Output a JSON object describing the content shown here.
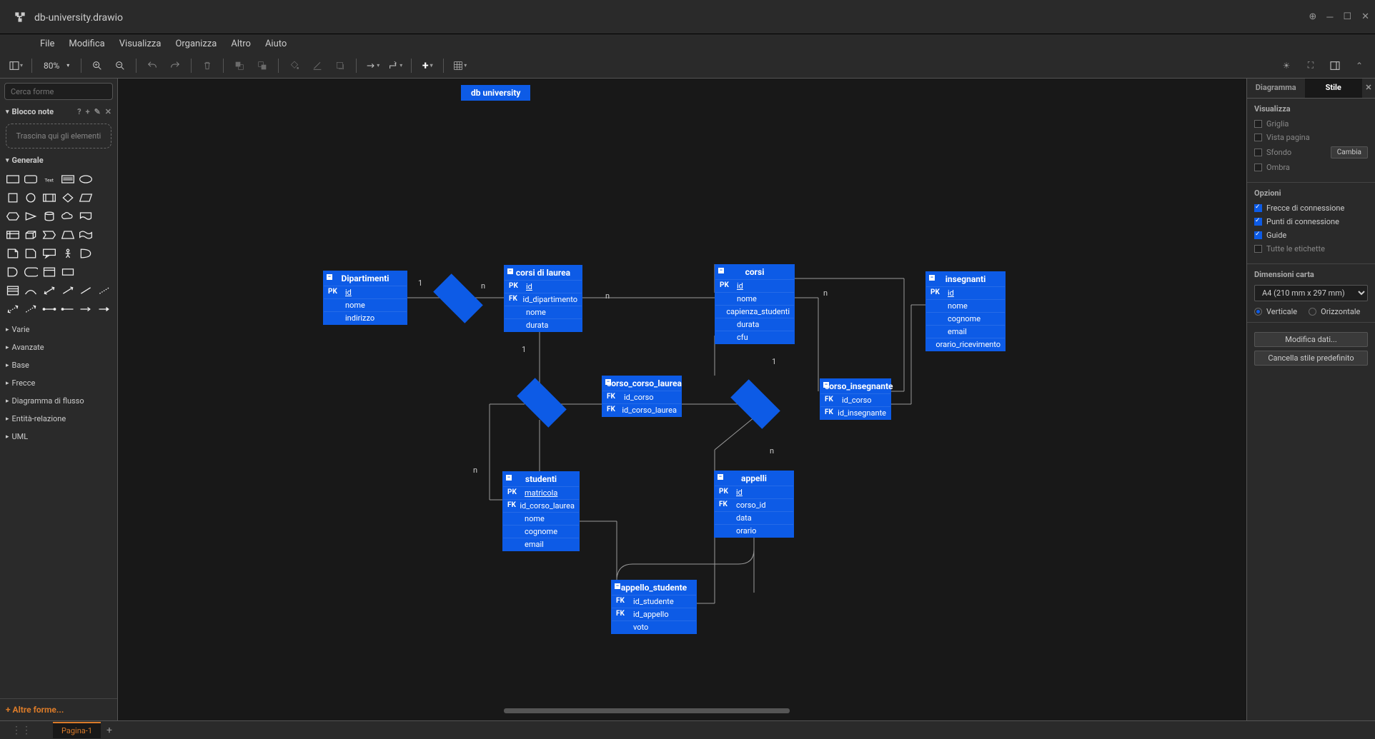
{
  "title": "db-university.drawio",
  "menubar": [
    "File",
    "Modifica",
    "Visualizza",
    "Organizza",
    "Altro",
    "Aiuto"
  ],
  "zoom": "80%",
  "search_placeholder": "Cerca forme",
  "left": {
    "scratchpad": "Blocco note",
    "dropzone": "Trascina qui gli elementi",
    "general": "Generale",
    "categories": [
      "Varie",
      "Avanzate",
      "Base",
      "Frecce",
      "Diagramma di flusso",
      "Entità-relazione",
      "UML"
    ],
    "more": "+  Altre forme..."
  },
  "canvas": {
    "title_chip": "db university",
    "tables": {
      "dipartimenti": {
        "title": "Dipartimenti",
        "rows": [
          {
            "k": "PK",
            "f": "id",
            "u": true
          },
          {
            "k": "",
            "f": "nome"
          },
          {
            "k": "",
            "f": "indirizzo"
          }
        ]
      },
      "corsi_laurea": {
        "title": "corsi di laurea",
        "rows": [
          {
            "k": "PK",
            "f": "id",
            "u": true
          },
          {
            "k": "FK",
            "f": "id_dipartimento"
          },
          {
            "k": "",
            "f": "nome"
          },
          {
            "k": "",
            "f": "durata"
          }
        ]
      },
      "corsi": {
        "title": "corsi",
        "rows": [
          {
            "k": "PK",
            "f": "id",
            "u": true
          },
          {
            "k": "",
            "f": "nome"
          },
          {
            "k": "",
            "f": "capienza_studenti"
          },
          {
            "k": "",
            "f": "durata"
          },
          {
            "k": "",
            "f": "cfu"
          }
        ]
      },
      "insegnanti": {
        "title": "insegnanti",
        "rows": [
          {
            "k": "PK",
            "f": "id",
            "u": true
          },
          {
            "k": "",
            "f": "nome"
          },
          {
            "k": "",
            "f": "cognome"
          },
          {
            "k": "",
            "f": "email"
          },
          {
            "k": "",
            "f": "orario_ricevimento"
          }
        ]
      },
      "corso_corso_laurea": {
        "title": "corso_corso_laurea",
        "rows": [
          {
            "k": "FK",
            "f": "id_corso"
          },
          {
            "k": "FK",
            "f": "id_corso_laurea"
          }
        ]
      },
      "corso_insegnante": {
        "title": "corso_insegnante",
        "rows": [
          {
            "k": "FK",
            "f": "id_corso"
          },
          {
            "k": "FK",
            "f": "id_insegnante"
          }
        ]
      },
      "studenti": {
        "title": "studenti",
        "rows": [
          {
            "k": "PK",
            "f": "matricola",
            "u": true
          },
          {
            "k": "FK",
            "f": "id_corso_laurea"
          },
          {
            "k": "",
            "f": "nome"
          },
          {
            "k": "",
            "f": "cognome"
          },
          {
            "k": "",
            "f": "email"
          }
        ]
      },
      "appelli": {
        "title": "appelli",
        "rows": [
          {
            "k": "PK",
            "f": "id",
            "u": true
          },
          {
            "k": "FK",
            "f": "corso_id"
          },
          {
            "k": "",
            "f": "data"
          },
          {
            "k": "",
            "f": "orario"
          }
        ]
      },
      "appello_studente": {
        "title": "appello_studente",
        "rows": [
          {
            "k": "FK",
            "f": "id_studente"
          },
          {
            "k": "FK",
            "f": "id_appello"
          },
          {
            "k": "",
            "f": "voto"
          }
        ]
      }
    },
    "labels": {
      "one": "1",
      "many": "n"
    }
  },
  "right": {
    "tabs": {
      "diagram": "Diagramma",
      "style": "Stile"
    },
    "visualize": "Visualizza",
    "opts": {
      "grid": "Griglia",
      "page": "Vista pagina",
      "bg": "Sfondo",
      "shadow": "Ombra",
      "change": "Cambia"
    },
    "options_title": "Opzioni",
    "options": {
      "arrows": "Frecce di connessione",
      "points": "Punti di connessione",
      "guides": "Guide",
      "labels": "Tutte le etichette"
    },
    "paper": "Dimensioni carta",
    "paper_size": "A4 (210 mm x 297 mm)",
    "orient": {
      "v": "Verticale",
      "h": "Orizzontale"
    },
    "edit_data": "Modifica dati...",
    "reset_style": "Cancella stile predefinito"
  },
  "page_tab": "Pagina-1"
}
